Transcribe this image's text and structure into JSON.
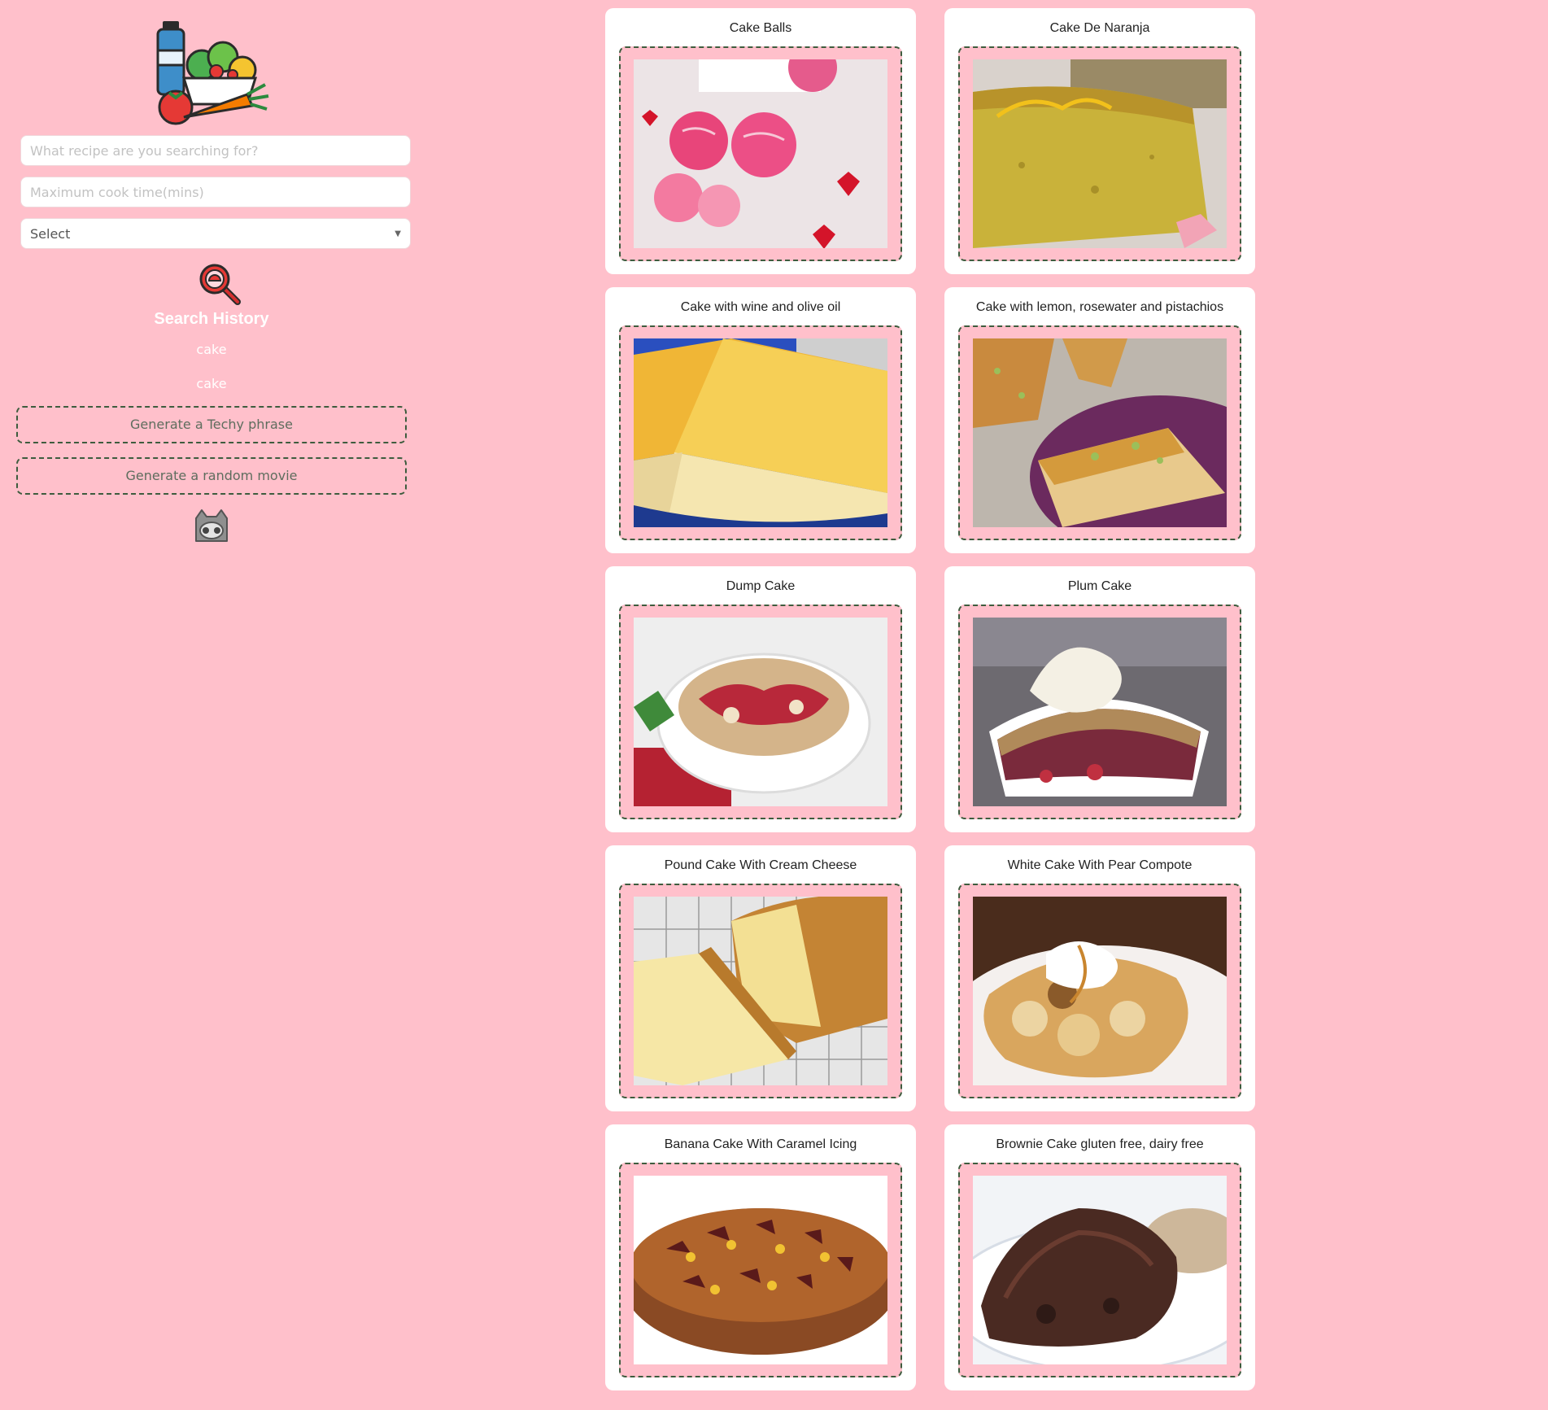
{
  "sidebar": {
    "logo_icon": "healthy-food-basket-icon",
    "search": {
      "placeholder": "What recipe are you searching for?",
      "value": ""
    },
    "cook_time": {
      "placeholder": "Maximum cook time(mins)",
      "value": ""
    },
    "select": {
      "selected": "Select",
      "icon": "caret-down-icon"
    },
    "history_icon": "magnifier-icon",
    "history_title": "Search History",
    "history": [
      "cake",
      "cake"
    ],
    "buttons": {
      "techy": "Generate a Techy phrase",
      "movie": "Generate a random movie"
    },
    "github_icon": "github-icon"
  },
  "colors": {
    "background": "#ffc0cb",
    "card": "#ffffff",
    "dashed_border": "#3e5c3e",
    "button_text": "#5e6d5e"
  },
  "recipes": [
    {
      "title": "Cake Balls",
      "image": "pink-cake-balls-photo"
    },
    {
      "title": "Cake De Naranja",
      "image": "orange-cake-slice-photo"
    },
    {
      "title": "Cake with wine and olive oil",
      "image": "yellow-cake-photo"
    },
    {
      "title": "Cake with lemon, rosewater and pistachios",
      "image": "pistachio-cake-photo"
    },
    {
      "title": "Dump Cake",
      "image": "dump-cake-photo"
    },
    {
      "title": "Plum Cake",
      "image": "plum-cake-photo"
    },
    {
      "title": "Pound Cake With Cream Cheese",
      "image": "pound-cake-photo"
    },
    {
      "title": "White Cake With Pear Compote",
      "image": "pear-compote-photo"
    },
    {
      "title": "Banana Cake With Caramel Icing",
      "image": "banana-caramel-cake-photo"
    },
    {
      "title": "Brownie Cake gluten free, dairy free",
      "image": "brownie-cake-photo"
    }
  ]
}
